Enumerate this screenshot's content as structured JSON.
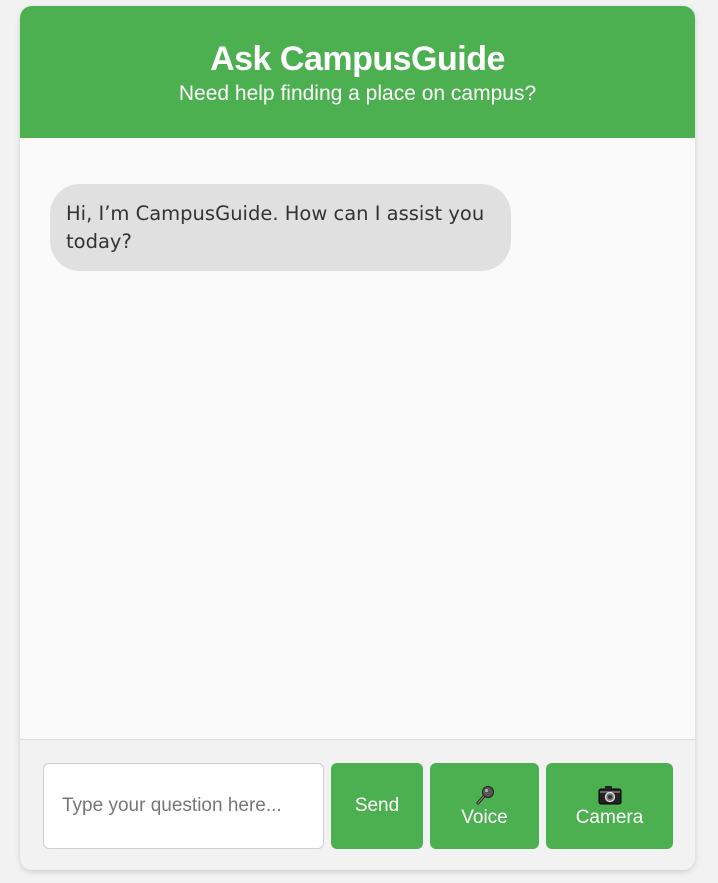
{
  "header": {
    "title": "Ask CampusGuide",
    "subtitle": "Need help finding a place on campus?"
  },
  "chat": {
    "messages": [
      {
        "sender": "bot",
        "text": "Hi, I’m CampusGuide. How can I assist you today?"
      }
    ]
  },
  "input": {
    "placeholder": "Type your question here...",
    "value": ""
  },
  "buttons": {
    "send_label": "Send",
    "voice_label": "Voice",
    "voice_icon": "microphone-icon",
    "camera_label": "Camera",
    "camera_icon": "camera-icon"
  },
  "colors": {
    "accent": "#4caf50",
    "bubble_bg": "#e0e0e0",
    "page_bg": "#f2f2f2"
  }
}
